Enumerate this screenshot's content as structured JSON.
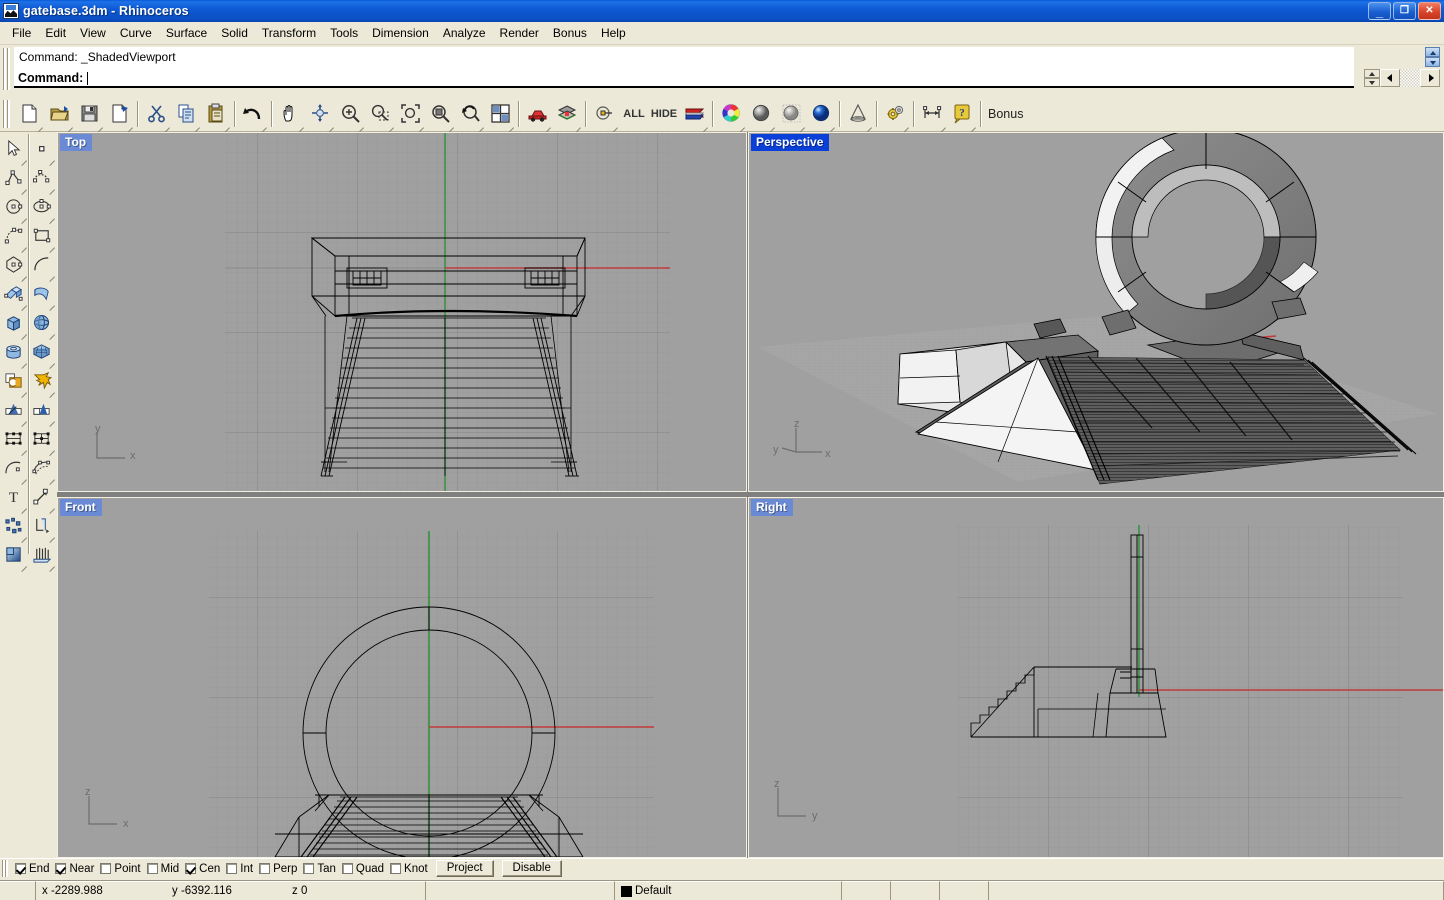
{
  "window": {
    "title": "gatebase.3dm - Rhinoceros",
    "icon": "rhino-app-icon",
    "buttons": [
      {
        "name": "minimize-button",
        "glyph": "_"
      },
      {
        "name": "restore-button",
        "glyph": "❐"
      },
      {
        "name": "close-button",
        "glyph": "✕"
      }
    ]
  },
  "menubar": {
    "items": [
      {
        "label": "File",
        "accel": "F"
      },
      {
        "label": "Edit",
        "accel": "E"
      },
      {
        "label": "View",
        "accel": "V"
      },
      {
        "label": "Curve",
        "accel": "C"
      },
      {
        "label": "Surface",
        "accel": "S"
      },
      {
        "label": "Solid",
        "accel": "l"
      },
      {
        "label": "Transform",
        "accel": "T"
      },
      {
        "label": "Tools",
        "accel": ""
      },
      {
        "label": "Dimension",
        "accel": "D"
      },
      {
        "label": "Analyze",
        "accel": "A"
      },
      {
        "label": "Render",
        "accel": "R"
      },
      {
        "label": "Bonus",
        "accel": "B"
      },
      {
        "label": "Help",
        "accel": "H"
      }
    ]
  },
  "command": {
    "history": "Command: _ShadedViewport",
    "prompt": "Command:",
    "input_value": "",
    "placeholder": ""
  },
  "toolbar": {
    "buttons": [
      {
        "name": "new-file-icon",
        "label": "New"
      },
      {
        "name": "open-file-icon",
        "label": "Open"
      },
      {
        "name": "save-file-icon",
        "label": "Save"
      },
      {
        "name": "print-icon",
        "label": "Print"
      },
      {
        "name": "cut-icon",
        "label": "Cut"
      },
      {
        "name": "copy-icon",
        "label": "Copy"
      },
      {
        "name": "paste-icon",
        "label": "Paste"
      },
      {
        "name": "undo-icon",
        "label": "Undo"
      },
      {
        "name": "pan-hand-icon",
        "label": "Pan"
      },
      {
        "name": "rotate-view-icon",
        "label": "Rotate View"
      },
      {
        "name": "zoom-in-icon",
        "label": "Zoom In"
      },
      {
        "name": "zoom-window-icon",
        "label": "Zoom Window"
      },
      {
        "name": "zoom-extents-icon",
        "label": "Zoom Extents"
      },
      {
        "name": "zoom-selected-icon",
        "label": "Zoom Selected"
      },
      {
        "name": "zoom-previous-icon",
        "label": "Zoom Previous"
      },
      {
        "name": "four-viewport-icon",
        "label": "4 Viewports"
      },
      {
        "name": "vehicle-icon",
        "label": "Render Preview"
      },
      {
        "name": "layers-icon",
        "label": "Layers"
      },
      {
        "name": "point-on-icon",
        "label": "Points On"
      },
      {
        "name": "select-all-text",
        "label": "ALL"
      },
      {
        "name": "hide-text",
        "label": "HIDE"
      },
      {
        "name": "flag-icon",
        "label": "Flag"
      },
      {
        "name": "color-wheel-icon",
        "label": "Color"
      },
      {
        "name": "shaded-sphere-icon",
        "label": "Shade"
      },
      {
        "name": "ghosted-sphere-icon",
        "label": "Ghosted"
      },
      {
        "name": "render-sphere-icon",
        "label": "Render"
      },
      {
        "name": "cone-light-icon",
        "label": "Spotlight"
      },
      {
        "name": "gears-icon",
        "label": "Options"
      },
      {
        "name": "dimension-icon",
        "label": "Dimension"
      },
      {
        "name": "help-icon",
        "label": "Help"
      },
      {
        "name": "bonus-text",
        "label": "Bonus"
      }
    ]
  },
  "sidebar": {
    "buttons": [
      {
        "name": "select-arrow-icon",
        "label": "Select"
      },
      {
        "name": "point-object-icon",
        "label": "Point"
      },
      {
        "name": "polyline-icon",
        "label": "Polyline"
      },
      {
        "name": "curve-icon",
        "label": "Curve"
      },
      {
        "name": "circle-icon",
        "label": "Circle"
      },
      {
        "name": "ellipse-icon",
        "label": "Ellipse"
      },
      {
        "name": "arc-icon",
        "label": "Arc"
      },
      {
        "name": "rectangle-icon",
        "label": "Rectangle"
      },
      {
        "name": "polygon-icon",
        "label": "Polygon"
      },
      {
        "name": "fillet-icon",
        "label": "Fillet"
      },
      {
        "name": "extrude-surface-icon",
        "label": "Extrude"
      },
      {
        "name": "sweep-surface-icon",
        "label": "Sweep"
      },
      {
        "name": "box-solid-icon",
        "label": "Box"
      },
      {
        "name": "sphere-solid-icon",
        "label": "Sphere"
      },
      {
        "name": "cylinder-solid-icon",
        "label": "Cylinder"
      },
      {
        "name": "mesh-icon",
        "label": "Mesh"
      },
      {
        "name": "boolean-icon",
        "label": "Boolean"
      },
      {
        "name": "explode-icon",
        "label": "Explode"
      },
      {
        "name": "trim-icon",
        "label": "Trim"
      },
      {
        "name": "split-icon",
        "label": "Split"
      },
      {
        "name": "control-points-icon",
        "label": "Control Points"
      },
      {
        "name": "edit-points-icon",
        "label": "Edit Points"
      },
      {
        "name": "offset-curve-icon",
        "label": "Offset"
      },
      {
        "name": "rebuild-curve-icon",
        "label": "Rebuild"
      },
      {
        "name": "text-tool-icon",
        "label": "Text"
      },
      {
        "name": "move-icon",
        "label": "Move"
      },
      {
        "name": "scatter-points-icon",
        "label": "Points"
      },
      {
        "name": "rotate-object-icon",
        "label": "Rotate"
      },
      {
        "name": "gradient-icon",
        "label": "Gradient"
      },
      {
        "name": "array-icon",
        "label": "Array"
      }
    ]
  },
  "viewports": [
    {
      "name": "Top",
      "label": "Top",
      "active": false,
      "axes": [
        "y",
        "x"
      ],
      "axis_style": "yx"
    },
    {
      "name": "Perspective",
      "label": "Perspective",
      "active": true,
      "axes": [
        "z",
        "x",
        "y"
      ],
      "axis_style": "zxy"
    },
    {
      "name": "Front",
      "label": "Front",
      "active": false,
      "axes": [
        "z",
        "x"
      ],
      "axis_style": "zx"
    },
    {
      "name": "Right",
      "label": "Right",
      "active": false,
      "axes": [
        "z",
        "y"
      ],
      "axis_style": "zy"
    }
  ],
  "osnap": {
    "items": [
      {
        "label": "End",
        "checked": true
      },
      {
        "label": "Near",
        "checked": true
      },
      {
        "label": "Point",
        "checked": false
      },
      {
        "label": "Mid",
        "checked": false
      },
      {
        "label": "Cen",
        "checked": true
      },
      {
        "label": "Int",
        "checked": false
      },
      {
        "label": "Perp",
        "checked": false
      },
      {
        "label": "Tan",
        "checked": false
      },
      {
        "label": "Quad",
        "checked": false
      },
      {
        "label": "Knot",
        "checked": false
      }
    ],
    "buttons": [
      {
        "name": "project-button",
        "label": "Project"
      },
      {
        "name": "disable-button",
        "label": "Disable"
      }
    ]
  },
  "status": {
    "x": "x -2289.988",
    "y": "y -6392.116",
    "z": "z 0",
    "layer": "Default",
    "layer_color": "#000000",
    "cells": [
      "",
      "",
      "",
      ""
    ]
  },
  "colors": {
    "title_blue": "#0b4fc4",
    "active_label": "#0a3fd8",
    "inactive_label": "#6a8ad6",
    "viewport_bg": "#a0a0a0",
    "chrome": "#ece9d8",
    "axis_x_red": "#c03b3b",
    "axis_y_green": "#2f8f38",
    "grid_line": "#949494",
    "grid_major": "#8a8a8a"
  }
}
